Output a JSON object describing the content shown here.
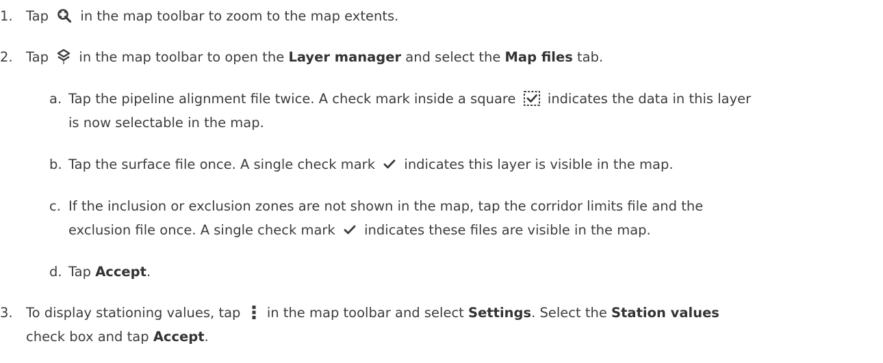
{
  "steps": [
    {
      "number": "1.",
      "parts": {
        "a": "Tap",
        "b": "in the map toolbar to zoom to the map extents."
      },
      "icon": "zoom-extents-icon"
    },
    {
      "number": "2.",
      "parts": {
        "a": "Tap",
        "b": "in the map toolbar to open the",
        "c": "Layer manager",
        "d": "and select the",
        "e": "Map files",
        "f": "tab."
      },
      "icon": "layers-icon",
      "substeps": [
        {
          "letter": "a.",
          "line1": "Tap the pipeline alignment file twice. A check mark inside a square",
          "line1_end": "indicates the data in this layer",
          "line2": "is now selectable in the map.",
          "icon": "selectable-check-icon"
        },
        {
          "letter": "b.",
          "pre": "Tap the surface file once. A single check mark",
          "post": "indicates this layer is visible in the map.",
          "icon": "check-icon"
        },
        {
          "letter": "c.",
          "line1": "If the inclusion or exclusion zones are not shown in the map, tap the corridor limits file and the",
          "line2_pre": "exclusion file once. A single check mark",
          "line2_post": "indicates these files are visible in the map.",
          "icon": "check-icon"
        },
        {
          "letter": "d.",
          "pre": "Tap",
          "bold": "Accept",
          "post": "."
        }
      ]
    },
    {
      "number": "3.",
      "line1": {
        "a": "To display stationing values, tap",
        "b": "in the map toolbar and select",
        "c": "Settings",
        "d": ". Select the",
        "e": "Station values"
      },
      "line2": {
        "a": "check box and tap",
        "b": "Accept",
        "c": "."
      },
      "icon": "more-vertical-icon"
    }
  ]
}
